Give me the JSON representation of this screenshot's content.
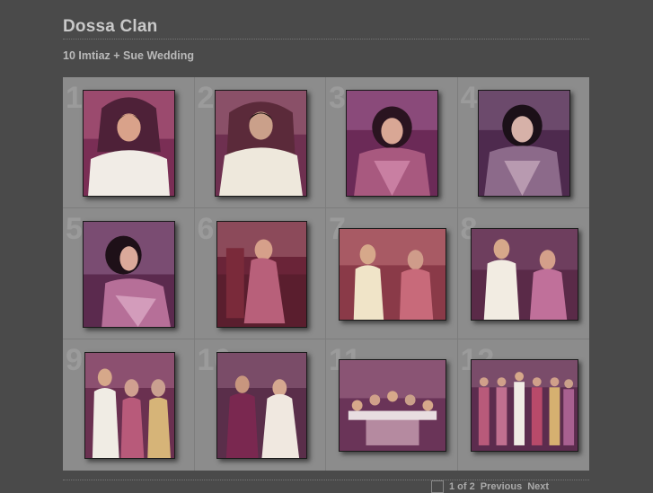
{
  "site": {
    "title": "Dossa Clan"
  },
  "gallery": {
    "title": "10 Imtiaz + Sue Wedding"
  },
  "thumbnails": [
    {
      "number": "1",
      "subject": "groom seated portrait"
    },
    {
      "number": "2",
      "subject": "groom seated portrait"
    },
    {
      "number": "3",
      "subject": "bride portrait"
    },
    {
      "number": "4",
      "subject": "bride portrait"
    },
    {
      "number": "5",
      "subject": "bride profile"
    },
    {
      "number": "6",
      "subject": "bride seated on throne"
    },
    {
      "number": "7",
      "subject": "couple seated"
    },
    {
      "number": "8",
      "subject": "couple standing"
    },
    {
      "number": "9",
      "subject": "ceremony group"
    },
    {
      "number": "10",
      "subject": "ceremony group"
    },
    {
      "number": "11",
      "subject": "stage group"
    },
    {
      "number": "12",
      "subject": "family group"
    }
  ],
  "pager": {
    "page": "1 of 2",
    "previous_label": "Previous",
    "next_label": "Next"
  },
  "colors": {
    "background": "#4a4a4a",
    "grid_background": "#8c8c8c",
    "title_text": "#c9c9c9"
  }
}
